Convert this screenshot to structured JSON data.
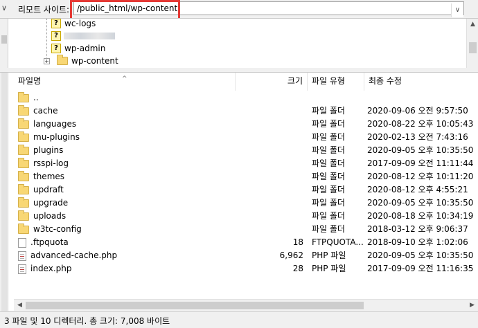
{
  "pathbar": {
    "left_chevron": "∨",
    "label": "리모트 사이트:",
    "path": "/public_html/wp-content",
    "dropdown": "∨",
    "highlight_color": "#e53935"
  },
  "tree": {
    "items": [
      {
        "label": "wc-logs",
        "icon": "unknown-folder-icon"
      },
      {
        "label": "",
        "icon": "unknown-folder-icon"
      },
      {
        "label": "wp-admin",
        "icon": "unknown-folder-icon"
      },
      {
        "label": "wp-content",
        "icon": "folder-icon",
        "expander": "+"
      }
    ]
  },
  "columns": {
    "name": "파일명",
    "size": "크기",
    "type": "파일 유형",
    "modified": "최종 수정"
  },
  "files": [
    {
      "name": "..",
      "icon": "folder",
      "size": "",
      "type": "",
      "modified": ""
    },
    {
      "name": "cache",
      "icon": "folder",
      "size": "",
      "type": "파일 폴더",
      "modified": "2020-09-06 오전 9:57:50"
    },
    {
      "name": "languages",
      "icon": "folder",
      "size": "",
      "type": "파일 폴더",
      "modified": "2020-08-22 오후 10:05:43"
    },
    {
      "name": "mu-plugins",
      "icon": "folder",
      "size": "",
      "type": "파일 폴더",
      "modified": "2020-02-13 오전 7:43:16"
    },
    {
      "name": "plugins",
      "icon": "folder",
      "size": "",
      "type": "파일 폴더",
      "modified": "2020-09-05 오후 10:35:50"
    },
    {
      "name": "rsspi-log",
      "icon": "folder",
      "size": "",
      "type": "파일 폴더",
      "modified": "2017-09-09 오전 11:11:44"
    },
    {
      "name": "themes",
      "icon": "folder",
      "size": "",
      "type": "파일 폴더",
      "modified": "2020-08-12 오후 10:11:20"
    },
    {
      "name": "updraft",
      "icon": "folder",
      "size": "",
      "type": "파일 폴더",
      "modified": "2020-08-12 오후 4:55:21"
    },
    {
      "name": "upgrade",
      "icon": "folder",
      "size": "",
      "type": "파일 폴더",
      "modified": "2020-09-05 오후 10:35:50"
    },
    {
      "name": "uploads",
      "icon": "folder",
      "size": "",
      "type": "파일 폴더",
      "modified": "2020-08-18 오후 10:34:19"
    },
    {
      "name": "w3tc-config",
      "icon": "folder",
      "size": "",
      "type": "파일 폴더",
      "modified": "2018-03-12 오후 9:06:37"
    },
    {
      "name": ".ftpquota",
      "icon": "file",
      "size": "18",
      "type": "FTPQUOTA...",
      "modified": "2018-09-10 오후 1:02:06"
    },
    {
      "name": "advanced-cache.php",
      "icon": "php",
      "size": "6,962",
      "type": "PHP 파일",
      "modified": "2020-09-05 오후 10:35:50"
    },
    {
      "name": "index.php",
      "icon": "php",
      "size": "28",
      "type": "PHP 파일",
      "modified": "2017-09-09 오전 11:16:35"
    }
  ],
  "status": "3 파일 및 10 디렉터리. 총 크기: 7,008 바이트"
}
